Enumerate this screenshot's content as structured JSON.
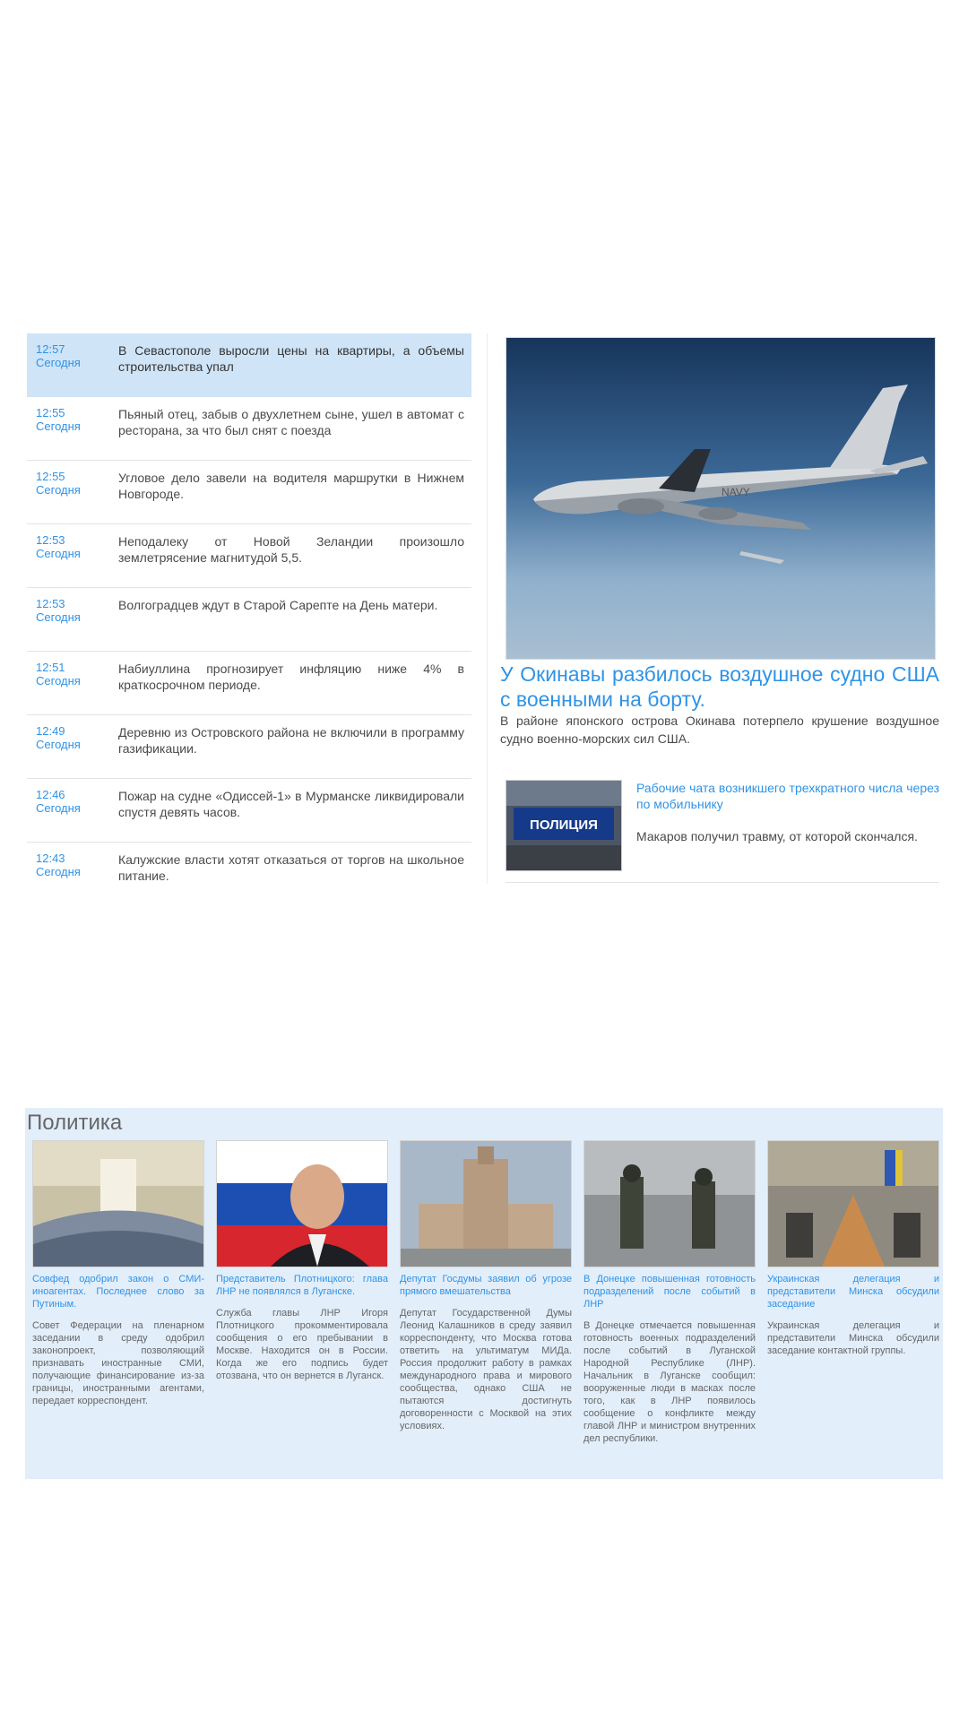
{
  "feed": [
    {
      "time": "12:57",
      "day": "Сегодня",
      "text": "В Севастополе выросли цены на квартиры, а объемы строительства упал"
    },
    {
      "time": "12:55",
      "day": "Сегодня",
      "text": "Пьяный отец, забыв о двухлетнем сыне, ушел в автомат с ресторана, за что был снят с поезда"
    },
    {
      "time": "12:55",
      "day": "Сегодня",
      "text": "Угловое дело завели на водителя маршрутки в Нижнем Новгороде."
    },
    {
      "time": "12:53",
      "day": "Сегодня",
      "text": "Неподалеку от Новой Зеландии произошло землетрясение магнитудой 5,5."
    },
    {
      "time": "12:53",
      "day": "Сегодня",
      "text": "Волгоградцев ждут в Старой Сарепте на День матери."
    },
    {
      "time": "12:51",
      "day": "Сегодня",
      "text": "Набиуллина прогнозирует инфляцию ниже 4% в краткосрочном периоде."
    },
    {
      "time": "12:49",
      "day": "Сегодня",
      "text": "Деревню из Островского района не включили в программу газификации."
    },
    {
      "time": "12:46",
      "day": "Сегодня",
      "text": "Пожар на судне «Одиссей-1» в Мурманске ликвидировали спустя девять часов."
    },
    {
      "time": "12:43",
      "day": "Сегодня",
      "text": "Калужские власти хотят отказаться от торгов на школьное питание."
    }
  ],
  "feature": {
    "title": "У Окинавы разбилось воздушное судно США с военными на борту.",
    "lead": "В районе японского острова Окинава потерпело крушение воздушное судно военно-морских сил США.",
    "image_label": "NAVY",
    "sub": {
      "thumb_label": "ПОЛИЦИЯ",
      "title": "Рабочие чата возникшего трехкратного числа через по мобильнику",
      "lead": "Макаров получил травму, от которой скончался."
    }
  },
  "politics": {
    "title": "Политика",
    "cards": [
      {
        "title": "Совфед одобрил закон о СМИ-иноагентах. Последнее слово за Путиным.",
        "text": "Совет Федерации на пленарном заседании в среду одобрил законопроект, позволяющий признавать иностранные СМИ, получающие финансирование из-за границы, иностранными агентами, передает корреспондент."
      },
      {
        "title": "Представитель Плотницкого: глава ЛНР не появлялся в Луганске.",
        "text": "Служба главы ЛНР Игоря Плотницкого прокомментировала сообщения о его пребывании в Москве. Находится он в России. Когда же его подпись будет отозвана, что он вернется в Луганск."
      },
      {
        "title": "Депутат Госдумы заявил об угрозе прямого вмешательства",
        "text": "Депутат Государственной Думы Леонид Калашников в среду заявил корреспонденту, что Москва готова ответить на ультиматум МИДа. Россия продолжит работу в рамках международного права и мирового сообщества, однако США не пытаются достигнуть договоренности с Москвой на этих условиях."
      },
      {
        "title": "В Донецке повышенная готовность подразделений после событий в ЛНР",
        "text": "В Донецке отмечается повышенная готовность военных подразделений после событий в Луганской Народной Республике (ЛНР). Начальник в Луганске сообщил: вооруженные люди в масках после того, как в ЛНР появилось сообщение о конфликте между главой ЛНР и министром внутренних дел республики."
      },
      {
        "title": "Украинская делегация и представители Минска обсудили заседание",
        "text": "Украинская делегация и представители Минска обсудили заседание контактной группы."
      }
    ]
  }
}
